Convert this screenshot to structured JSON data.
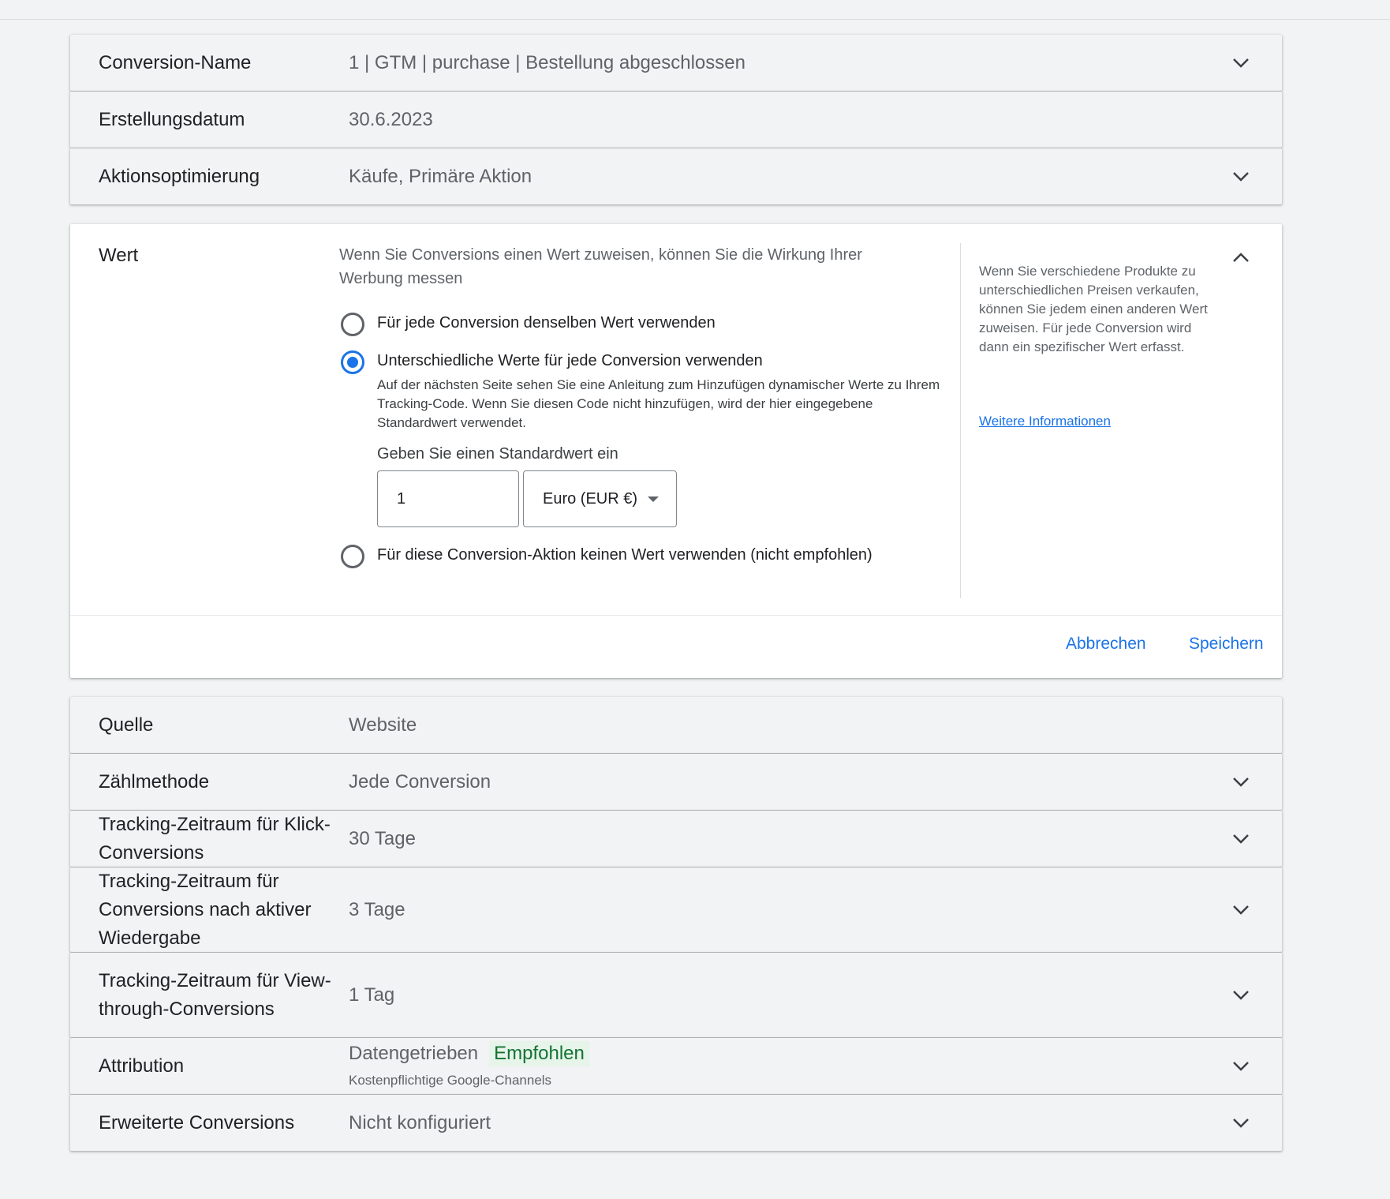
{
  "rows_top": [
    {
      "label": "Conversion-Name",
      "value": "1 | GTM | purchase | Bestellung abgeschlossen",
      "chevron": true
    },
    {
      "label": "Erstellungsdatum",
      "value": "30.6.2023",
      "chevron": false
    },
    {
      "label": "Aktionsoptimierung",
      "value": "Käufe, Primäre Aktion",
      "chevron": true
    }
  ],
  "value_panel": {
    "title": "Wert",
    "intro": "Wenn Sie Conversions einen Wert zuweisen, können Sie die Wirkung Ihrer Werbung messen",
    "option_same": "Für jede Conversion denselben Wert verwenden",
    "option_different": "Unterschiedliche Werte für jede Conversion verwenden",
    "option_different_desc": "Auf der nächsten Seite sehen Sie eine Anleitung zum Hinzufügen dynamischer Werte zu Ihrem Tracking-Code. Wenn Sie diesen Code nicht hinzufügen, wird der hier eingegebene Standardwert verwendet.",
    "default_label": "Geben Sie einen Standardwert ein",
    "default_value": "1",
    "currency": "Euro (EUR €)",
    "option_none": "Für diese Conversion-Aktion keinen Wert verwenden (nicht empfohlen)",
    "selected": "different",
    "side_text": "Wenn Sie verschiedene Produkte zu unterschiedlichen Preisen verkaufen, können Sie jedem einen anderen Wert zuweisen. Für jede Conversion wird dann ein spezifischer Wert erfasst.",
    "side_link": "Weitere Informationen",
    "cancel": "Abbrechen",
    "save": "Speichern"
  },
  "rows_bottom": [
    {
      "label": "Quelle",
      "value": "Website",
      "chevron": false
    },
    {
      "label": "Zählmethode",
      "value": "Jede Conversion",
      "chevron": true
    },
    {
      "label": "Tracking-Zeitraum für Klick-Conversions",
      "value": "30 Tage",
      "chevron": true
    },
    {
      "label": "Tracking-Zeitraum für Conversions nach aktiver Wiedergabe",
      "value": "3 Tage",
      "chevron": true
    },
    {
      "label": "Tracking-Zeitraum für View-through-Conversions",
      "value": "1 Tag",
      "chevron": true
    }
  ],
  "attribution": {
    "label": "Attribution",
    "value": "Datengetrieben",
    "badge": "Empfohlen",
    "sub": "Kostenpflichtige Google-Channels"
  },
  "enhanced": {
    "label": "Erweiterte Conversions",
    "value": "Nicht konfiguriert"
  },
  "colors": {
    "accent": "#1a73e8",
    "badge_bg": "#e6f4ea",
    "badge_text": "#137333",
    "page_bg": "#f1f3f4"
  },
  "icons": {
    "collapsed": "chevron-down-icon",
    "expanded": "chevron-up-icon"
  }
}
